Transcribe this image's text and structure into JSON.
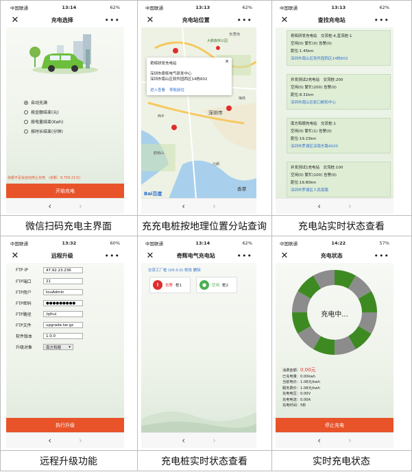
{
  "colors": {
    "accent": "#e8532a",
    "ring_green": "#3e8a22",
    "ring_gray": "#8c8c8c",
    "link": "#2e6fd0",
    "warn": "#e02d2d",
    "ok": "#4caf50"
  },
  "captions": [
    "微信扫码充电主界面",
    "充充电桩按地理位置分站查询",
    "充电站实时状态查看",
    "远程升级功能",
    "充电桩实时状态查看",
    "实时充电状态"
  ],
  "nav": {
    "back": "‹",
    "forward": "›",
    "close": "✕",
    "more": "•••"
  },
  "s1": {
    "status": {
      "carrier": "中国联通",
      "time": "13:14",
      "battery": "62%"
    },
    "title": "充电选择",
    "options": [
      {
        "label": "自动充满",
        "checked": true
      },
      {
        "label": "按金额结束(元)",
        "checked": false
      },
      {
        "label": "按电量结束(Kwh)",
        "checked": false
      },
      {
        "label": "按时长结束(分钟)",
        "checked": false
      }
    ],
    "balance_note": "余额不足会自动停止充电　(余额：8,758.21元)",
    "start_btn": "开始充电"
  },
  "s2": {
    "status": {
      "carrier": "中国联通",
      "time": "13:13",
      "battery": "62%"
    },
    "title": "充电站位置",
    "popup": {
      "name": "奇辉研发充电站",
      "org": "深圳市奇辉电气研发中心",
      "addr": "深圳市南山区软件园西区14栋602",
      "link1": "进入查看",
      "link2": "导航前往"
    },
    "map_labels": [
      "深圳市",
      "东莞市",
      "香港",
      "大鹏森林公园",
      "元朗",
      "鹤南山",
      "西乡",
      "梅林"
    ],
    "baidu": "Bai百度"
  },
  "s3": {
    "status": {
      "carrier": "中国联通",
      "time": "13:13",
      "battery": "62%"
    },
    "title": "查找充电站",
    "stations": [
      {
        "name": "奇辉研发充电站",
        "piles": "交流桩:4,直流桩:1",
        "status": "空闲(0) 繁忙(0) 告警(0)",
        "dist": "距位:1.45km",
        "addr": "深圳市南山区软件园西区14栋602"
      },
      {
        "name": "井发测试2充电站",
        "piles": "交流桩:200",
        "status": "空闲(0) 繁忙(200) 告警(0)",
        "dist": "距位:8.31km",
        "addr": "深圳市南山区蛇口邮轮中心"
      },
      {
        "name": "南方和顺充电站",
        "piles": "交流桩:1",
        "status": "空闲(0) 繁忙(1) 告警(0)",
        "dist": "距位:19.23km",
        "addr": "深圳市罗湖区深南东路4020"
      },
      {
        "name": "井发测试1充电站",
        "piles": "交流桩:100",
        "status": "空闲(0) 繁忙(100) 告警(0)",
        "dist": "距位:19.80km",
        "addr": "深圳市罗湖区人民南路"
      }
    ]
  },
  "s4": {
    "status": {
      "carrier": "中国联通",
      "time": "13:32",
      "battery": "60%"
    },
    "title": "远程升级",
    "fields": [
      {
        "label": "FTP IP",
        "value": "47.92.23.236"
      },
      {
        "label": "FTP端口",
        "value": "21"
      },
      {
        "label": "FTP用户",
        "value": "touAdmin"
      },
      {
        "label": "FTP密码",
        "value": "●●●●●●●●●"
      },
      {
        "label": "FTP路径",
        "value": "/qihui"
      },
      {
        "label": "FTP文件",
        "value": "upgrade.tar.gz"
      },
      {
        "label": "软件版本",
        "value": "1.0.0"
      }
    ],
    "target_label": "升级对象",
    "target_value": "南方和顺",
    "exec_btn": "执行升级"
  },
  "s5": {
    "status": {
      "carrier": "中国联通",
      "time": "13:14",
      "battery": "62%"
    },
    "title": "奇辉电气充电站",
    "topline": "交流工厂桩 (V0.0.0)   修改  删除",
    "piles": [
      {
        "state": "告警",
        "name": "桩1"
      },
      {
        "state": "空闲",
        "name": "桩2"
      }
    ]
  },
  "s6": {
    "status": {
      "carrier": "中国联通",
      "time": "14:22",
      "battery": "57%"
    },
    "title": "充电状态",
    "center_text": "充电中...",
    "segments": 12,
    "amount_label": "消费金额：",
    "amount_value": "0.00元",
    "stats": [
      "已充电量：0.00kwh",
      "当前电价：1.08元/kwh",
      "服务费价：1.08元/kwh",
      "充电电压：0.00V",
      "充电电流：0.00A",
      "充电时间：5秒"
    ],
    "stop_btn": "停止充电"
  }
}
